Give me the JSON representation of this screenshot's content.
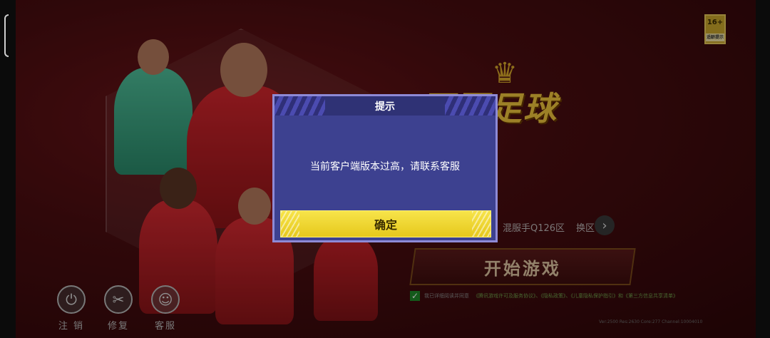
{
  "background": {
    "logo_text": "冠军足球",
    "age_rating": "16+",
    "age_rating_sub": "适龄提示",
    "server_name": "混服手Q126区",
    "switch_server_label": "换区",
    "start_game_label": "开始游戏",
    "agreement_text": "我已详细阅读并同意",
    "agreement_links": "《腾讯游戏许可及服务协议》、《隐私政策》、《儿童隐私保护指引》和《第三方信息共享清单》",
    "version_info": "Ver:2500 Res:2630 Core:277 Channel:10004010"
  },
  "bottom_menu": [
    {
      "label": "注 销",
      "icon": "power-icon"
    },
    {
      "label": "修复",
      "icon": "tools-icon"
    },
    {
      "label": "客服",
      "icon": "support-icon"
    }
  ],
  "dialog": {
    "title": "提示",
    "message": "当前客户端版本过高，请联系客服",
    "confirm_label": "确定"
  },
  "colors": {
    "dialog_bg": "#3d4190",
    "confirm_button": "#f2dc36",
    "background_red": "#4a0d10"
  }
}
